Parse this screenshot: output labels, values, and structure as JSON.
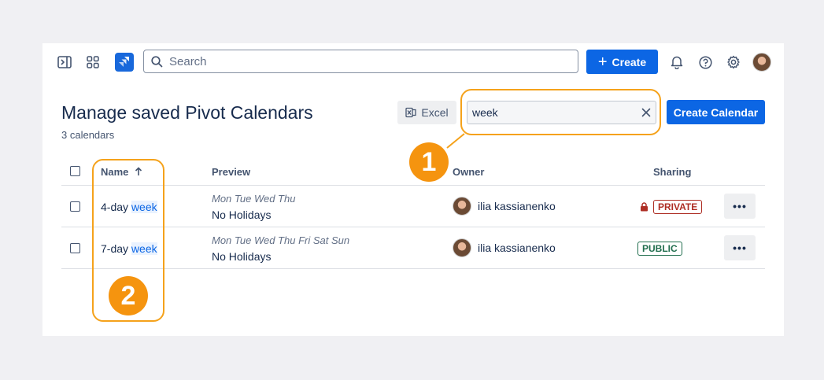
{
  "topbar": {
    "search_placeholder": "Search",
    "create_label": "Create"
  },
  "page": {
    "title": "Manage saved Pivot Calendars",
    "count": "3 calendars",
    "excel_label": "Excel",
    "filter_value": "week",
    "create_calendar_label": "Create Calendar"
  },
  "table": {
    "headers": {
      "name": "Name",
      "preview": "Preview",
      "owner": "Owner",
      "sharing": "Sharing"
    },
    "rows": [
      {
        "name_prefix": "4-day ",
        "name_match": "week",
        "preview_days": "Mon Tue Wed Thu",
        "preview_holidays": "No Holidays",
        "owner": "ilia kassianenko",
        "sharing": "PRIVATE"
      },
      {
        "name_prefix": "7-day ",
        "name_match": "week",
        "preview_days": "Mon Tue Wed Thu Fri Sat Sun",
        "preview_holidays": "No Holidays",
        "owner": "ilia kassianenko",
        "sharing": "PUBLIC"
      }
    ]
  },
  "annotations": {
    "marker_1": "1",
    "marker_2": "2"
  },
  "colors": {
    "accent": "#0c66e4",
    "callout": "#f5a21b",
    "private": "#ae2e24",
    "public": "#216e4e"
  }
}
